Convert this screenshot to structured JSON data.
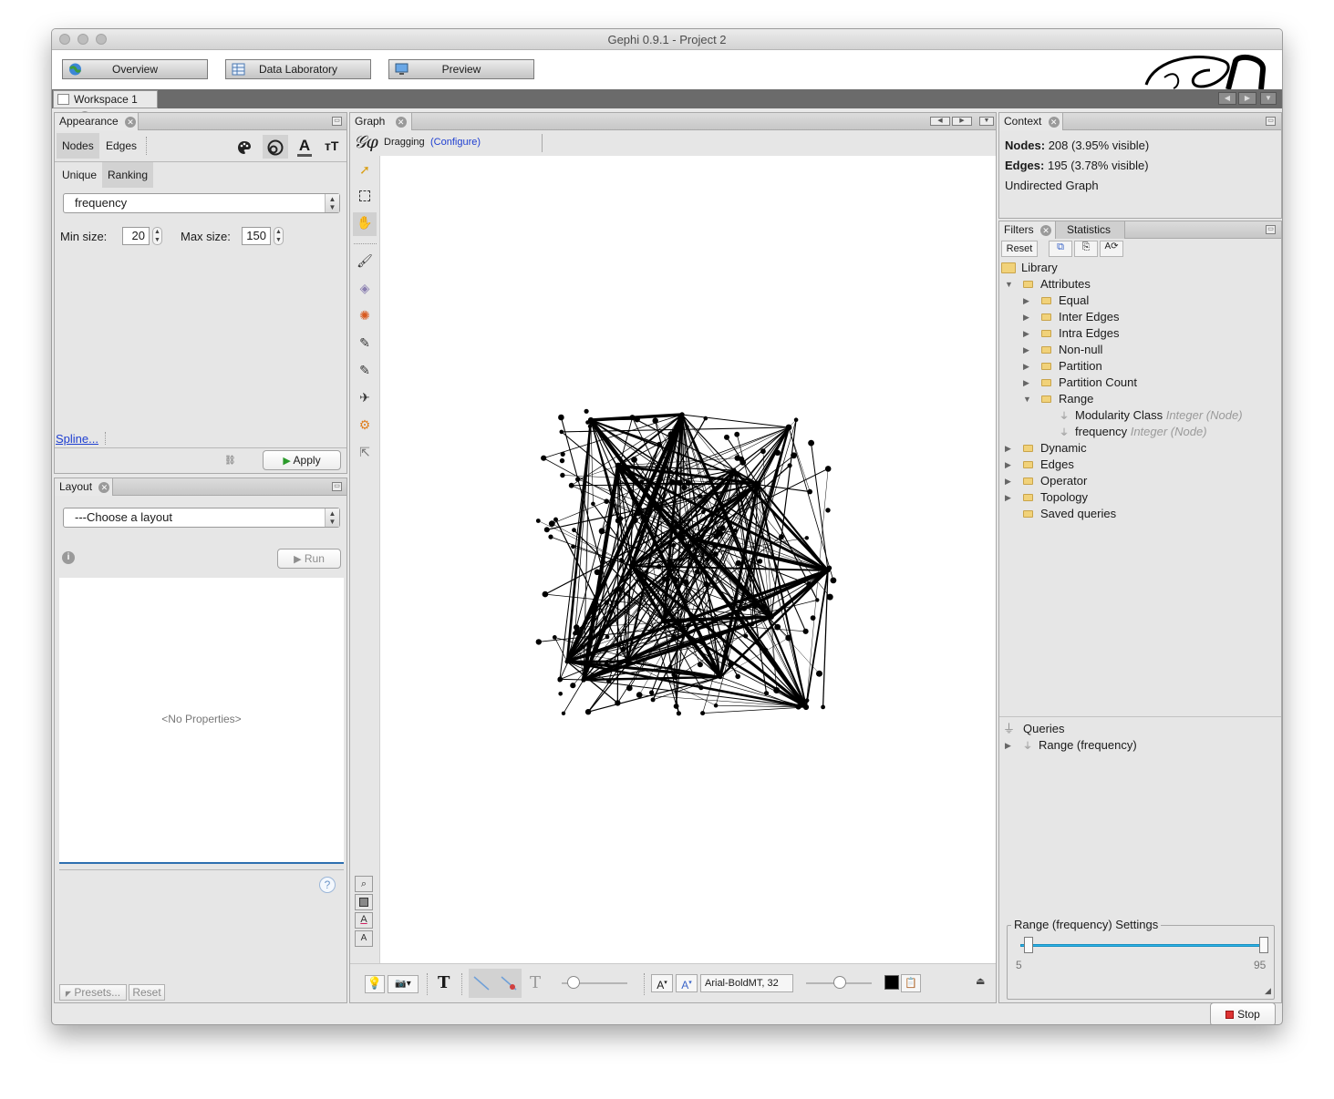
{
  "window": {
    "title": "Gephi 0.9.1 - Project 2"
  },
  "top_buttons": {
    "overview": "Overview",
    "data_lab": "Data Laboratory",
    "preview": "Preview"
  },
  "workspace_tab": "Workspace 1",
  "appearance": {
    "tab": "Appearance",
    "modes": [
      "Nodes",
      "Edges"
    ],
    "subtabs": [
      "Unique",
      "Ranking"
    ],
    "attribute": "frequency",
    "min_label": "Min size:",
    "min_value": "20",
    "max_label": "Max size:",
    "max_value": "150",
    "spline": "Spline...",
    "apply": "Apply"
  },
  "layout": {
    "tab": "Layout",
    "choose": "---Choose a layout",
    "run": "Run",
    "no_props": "<No Properties>",
    "presets": "Presets...",
    "reset": "Reset"
  },
  "graph": {
    "tab": "Graph",
    "mode": "Dragging",
    "configure": "(Configure)",
    "font_label": "Arial-BoldMT, 32",
    "accent": "#1f3fd1",
    "node_color": "#000000"
  },
  "context": {
    "tab": "Context",
    "nodes_label": "Nodes:",
    "nodes_value": "208 (3.95% visible)",
    "edges_label": "Edges:",
    "edges_value": "195 (3.78% visible)",
    "type": "Undirected Graph"
  },
  "filters": {
    "tabs": [
      "Filters",
      "Statistics"
    ],
    "reset": "Reset",
    "library": "Library",
    "tree": [
      {
        "label": "Attributes"
      },
      {
        "label": "Equal"
      },
      {
        "label": "Inter Edges"
      },
      {
        "label": "Intra Edges"
      },
      {
        "label": "Non-null"
      },
      {
        "label": "Partition"
      },
      {
        "label": "Partition Count"
      },
      {
        "label": "Range"
      },
      {
        "label": "Modularity Class",
        "type": "Integer (Node)"
      },
      {
        "label": "frequency",
        "type": "Integer (Node)"
      },
      {
        "label": "Dynamic"
      },
      {
        "label": "Edges"
      },
      {
        "label": "Operator"
      },
      {
        "label": "Topology"
      },
      {
        "label": "Saved queries"
      }
    ],
    "queries": "Queries",
    "query_item": "Range (frequency)",
    "settings_title": "Range (frequency) Settings",
    "range_min": "5",
    "range_max": "95",
    "stop": "Stop"
  }
}
